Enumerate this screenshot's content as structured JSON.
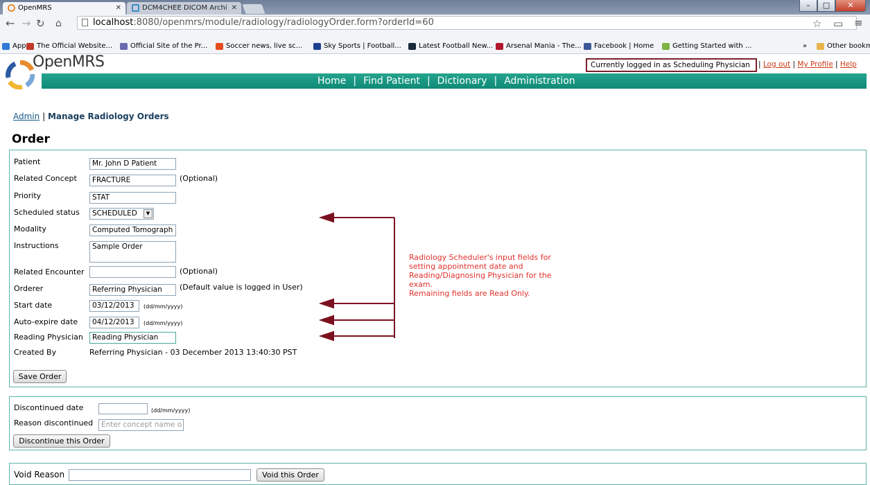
{
  "browser": {
    "tabs": [
      {
        "label": "OpenMRS",
        "active": true
      },
      {
        "label": "DCM4CHEE DICOM Archi",
        "active": false
      }
    ],
    "url_host": "localhost",
    "url_rest": ":8080/openmrs/module/radiology/radiologyOrder.form?orderId=60",
    "bookmarks": [
      {
        "label": "Apps",
        "color": "#2f7bd6"
      },
      {
        "label": "The Official Website...",
        "color": "#c0392b"
      },
      {
        "label": "Official Site of the Pr...",
        "color": "#6b6bb0"
      },
      {
        "label": "Soccer news, live sc...",
        "color": "#e74c1c"
      },
      {
        "label": "Sky Sports | Football...",
        "color": "#1d3f8f"
      },
      {
        "label": "Latest Football New...",
        "color": "#1b2a3a"
      },
      {
        "label": "Arsenal Mania - The...",
        "color": "#b0152a"
      },
      {
        "label": "Facebook | Home",
        "color": "#3b5998"
      },
      {
        "label": "Getting Started with ...",
        "color": "#7cb342"
      },
      {
        "label": "Other bookmarks",
        "color": "#e8b44a"
      }
    ],
    "overflow_label": "»"
  },
  "header": {
    "logo_text": "OpenMRS",
    "login_text": "Currently logged in as Scheduling Physician",
    "links": [
      "Log out",
      "My Profile",
      "Help"
    ],
    "nav": [
      "Home",
      "Find Patient",
      "Dictionary",
      "Administration"
    ]
  },
  "breadcrumb": {
    "admin": "Admin",
    "current": "Manage Radiology Orders"
  },
  "title": "Order",
  "order_form": {
    "patient": {
      "label": "Patient",
      "value": "Mr. John D Patient"
    },
    "related_concept": {
      "label": "Related Concept",
      "value": "FRACTURE",
      "note": "(Optional)"
    },
    "priority": {
      "label": "Priority",
      "value": "STAT"
    },
    "scheduled_status": {
      "label": "Scheduled status",
      "value": "SCHEDULED"
    },
    "modality": {
      "label": "Modality",
      "value": "Computed Tomograph"
    },
    "instructions": {
      "label": "Instructions",
      "value": "Sample Order"
    },
    "related_encounter": {
      "label": "Related Encounter",
      "value": "",
      "note": "(Optional)"
    },
    "orderer": {
      "label": "Orderer",
      "value": "Referring Physician",
      "note": "(Default value is logged in User)"
    },
    "start_date": {
      "label": "Start date",
      "value": "03/12/2013",
      "format": "(dd/mm/yyyy)"
    },
    "auto_expire_date": {
      "label": "Auto-expire date",
      "value": "04/12/2013",
      "format": "(dd/mm/yyyy)"
    },
    "reading_physician": {
      "label": "Reading Physician",
      "value": "Reading Physician"
    },
    "created_by": {
      "label": "Created By",
      "value": "Referring Physician - 03 December 2013 13:40:30 PST"
    },
    "save_button": "Save Order"
  },
  "annotation": {
    "lines": [
      "Radiology Scheduler's input fields for",
      "setting appointment date and",
      "Reading/Diagnosing Physician for the",
      "exam.",
      "Remaining fields are Read Only."
    ],
    "color": "#e0302a",
    "arrow_color": "#7b1020"
  },
  "discontinue_form": {
    "date_label": "Discontinued date",
    "date_value": "",
    "date_format": "(dd/mm/yyyy)",
    "reason_label": "Reason discontinued",
    "reason_placeholder": "Enter concept name o",
    "button": "Discontinue this Order"
  },
  "void_form": {
    "label": "Void Reason",
    "value": "",
    "button": "Void this Order"
  },
  "colors": {
    "teal": "#129a84",
    "box_border": "#5ab5a8",
    "link": "#cc3b16"
  }
}
